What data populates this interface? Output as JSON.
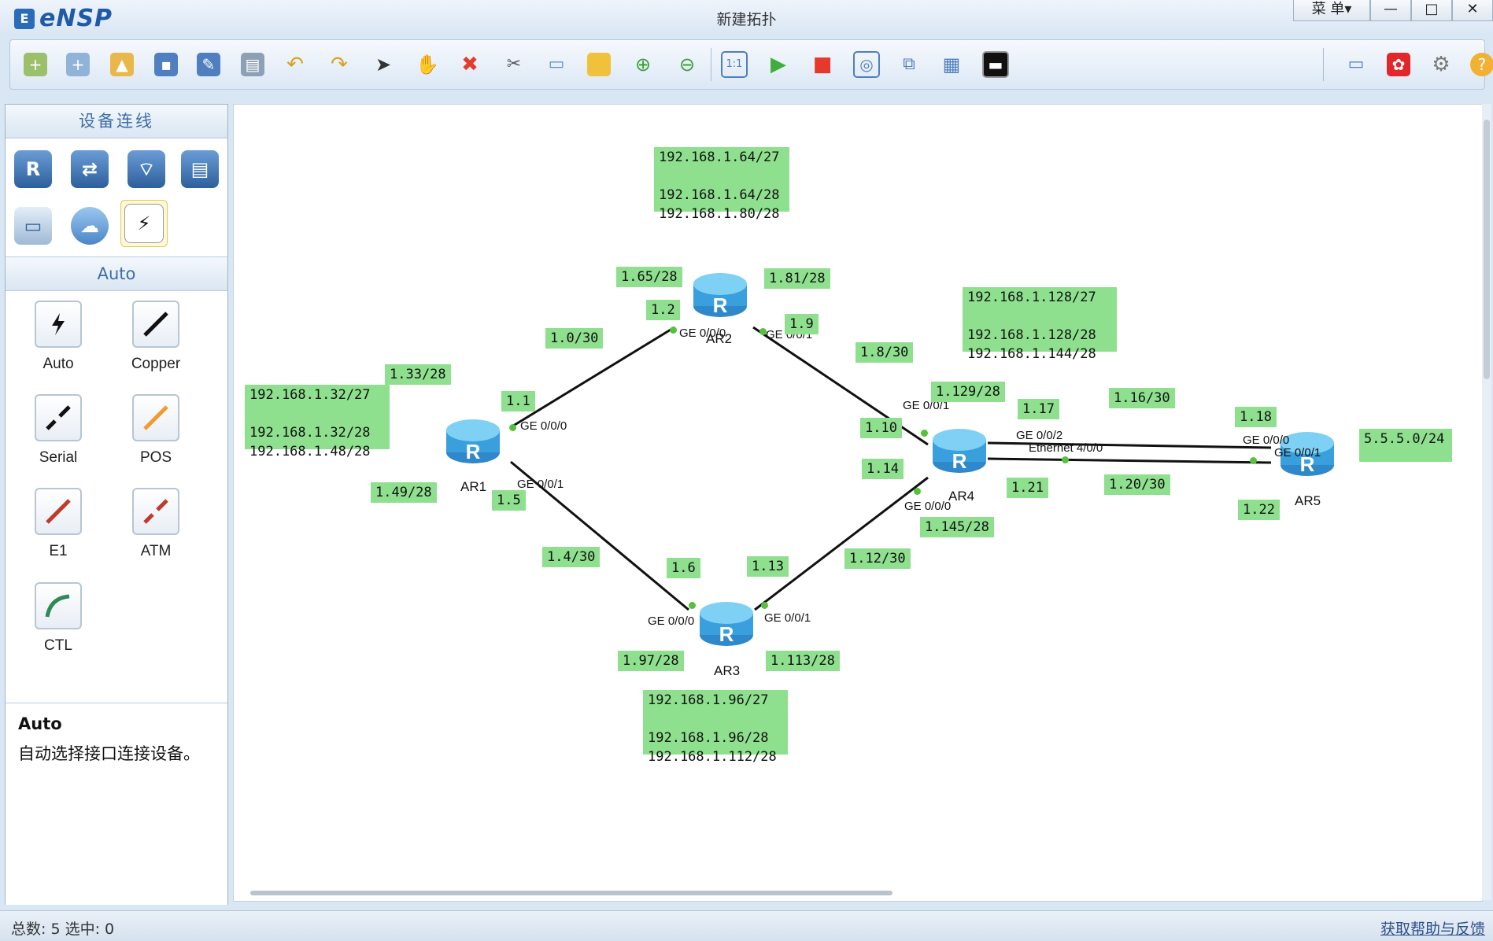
{
  "app": {
    "name": "eNSP",
    "window_title": "新建拓扑",
    "menu_label": "菜 单▾"
  },
  "window_buttons": {
    "minimize": "—",
    "maximize": "□",
    "close": "✕"
  },
  "toolbar": {
    "icons": [
      "new-topology-icon",
      "new-lab-icon",
      "open-icon",
      "save-icon",
      "save-as-icon",
      "print-icon",
      "undo-icon",
      "redo-icon",
      "select-icon",
      "pan-icon",
      "delete-icon",
      "delete-link-icon",
      "text-icon",
      "rectangle-icon",
      "zoom-in-icon",
      "zoom-out-icon",
      "fit-icon",
      "start-icon",
      "stop-icon",
      "capture-icon",
      "topology-icon",
      "grid-icon",
      "terminal-icon",
      "message-icon",
      "huawei-icon",
      "settings-icon",
      "help-icon"
    ]
  },
  "left_panel": {
    "section_title": "设备连线",
    "devices": [
      "router-icon",
      "switch-icon",
      "wlan-icon",
      "firewall-icon",
      "pc-icon",
      "cloud-icon",
      "cable-icon"
    ],
    "cable_section_title": "Auto",
    "cables": [
      {
        "label": "Auto",
        "color": "#000000"
      },
      {
        "label": "Copper",
        "color": "#000000"
      },
      {
        "label": "Serial",
        "color": "#000000"
      },
      {
        "label": "POS",
        "color": "#f29a2e"
      },
      {
        "label": "E1",
        "color": "#c0392b"
      },
      {
        "label": "ATM",
        "color": "#c0392b"
      },
      {
        "label": "CTL",
        "color": "#2e8b57"
      }
    ],
    "description": {
      "title": "Auto",
      "text": "自动选择接口连接设备。"
    }
  },
  "topology": {
    "devices": [
      {
        "name": "AR1"
      },
      {
        "name": "AR2"
      },
      {
        "name": "AR3"
      },
      {
        "name": "AR4"
      },
      {
        "name": "AR5"
      }
    ],
    "notes": {
      "ar2_subnets": "192.168.1.64/27\n\n192.168.1.64/28\n192.168.1.80/28",
      "ar4_subnets": "192.168.1.128/27\n\n192.168.1.128/28\n192.168.1.144/28",
      "ar1_subnets": "192.168.1.32/27\n\n192.168.1.32/28\n192.168.1.48/28",
      "ar3_subnets": "192.168.1.96/27\n\n192.168.1.96/28\n192.168.1.112/28",
      "ar5_net": "5.5.5.0/24",
      "n_165": "1.65/28",
      "n_181": "1.81/28",
      "n_12": "1.2",
      "n_19": "1.9",
      "n_10_30": "1.0/30",
      "n_8_30": "1.8/30",
      "n_133": "1.33/28",
      "n_11": "1.1",
      "n_149": "1.49/28",
      "n_15": "1.5",
      "n_129": "1.129/28",
      "n_117": "1.17",
      "n_16_30": "1.16/30",
      "n_118": "1.18",
      "n_110": "1.10",
      "n_114": "1.14",
      "n_121": "1.21",
      "n_20_30": "1.20/30",
      "n_122": "1.22",
      "n_145": "1.145/28",
      "n_4_30": "1.4/30",
      "n_16": "1.6",
      "n_113": "1.13",
      "n_12_30": "1.12/30",
      "n_197": "1.97/28",
      "n_1113": "1.113/28"
    },
    "interfaces": {
      "ar1_g0": "GE 0/0/0",
      "ar1_g1": "GE 0/0/1",
      "ar2_g0": "GE 0/0/0",
      "ar2_g1": "GE 0/0/1",
      "ar3_g0": "GE 0/0/0",
      "ar3_g1": "GE 0/0/1",
      "ar4_g1": "GE 0/0/1",
      "ar4_g0": "GE 0/0/0",
      "ar4_g2": "GE 0/0/2",
      "ar4_e": "Ethernet 4/0/0",
      "ar5_g0": "GE 0/0/0",
      "ar5_g1": "GE 0/0/1"
    }
  },
  "status": {
    "left": "总数: 5  选中: 0",
    "right": "获取帮助与反馈"
  }
}
